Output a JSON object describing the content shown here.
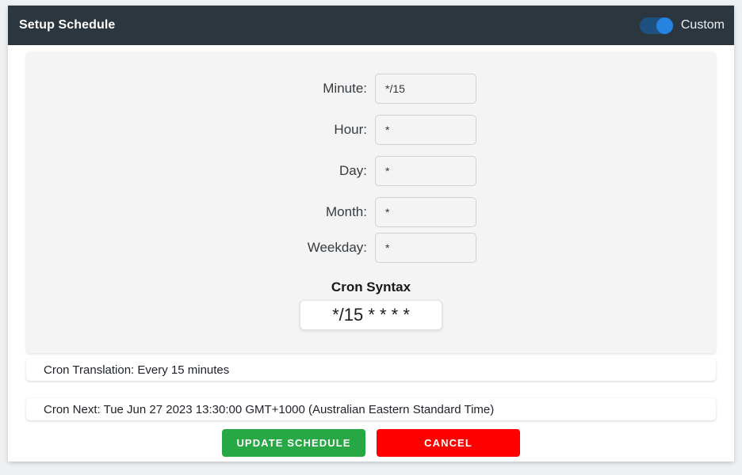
{
  "header": {
    "title": "Setup Schedule",
    "toggle_label": "Custom",
    "toggle_on": true,
    "toggle_icon": "toggle-switch-icon",
    "bg_color": "#2b363f",
    "toggle_track_color": "#1f5180",
    "toggle_knob_color": "#2684e0"
  },
  "fields": [
    {
      "label": "Minute:",
      "value": "*/15",
      "placeholder": ""
    },
    {
      "label": "Hour:",
      "value": "*",
      "placeholder": ""
    },
    {
      "label": "Day:",
      "value": "*",
      "placeholder": ""
    },
    {
      "label": "Month:",
      "value": "*",
      "placeholder": ""
    },
    {
      "label": "Weekday:",
      "value": "*",
      "placeholder": ""
    }
  ],
  "cron_syntax": {
    "heading": "Cron Syntax",
    "value": "*/15 * * * *",
    "placeholder": ""
  },
  "info": {
    "translation": "Cron Translation: Every 15 minutes",
    "next": "Cron Next: Tue Jun 27 2023 13:30:00 GMT+1000 (Australian Eastern Standard Time)"
  },
  "buttons": {
    "update_label": "UPDATE SCHEDULE",
    "cancel_label": "CANCEL",
    "update_color": "#28a745",
    "cancel_color": "#fe0000"
  }
}
